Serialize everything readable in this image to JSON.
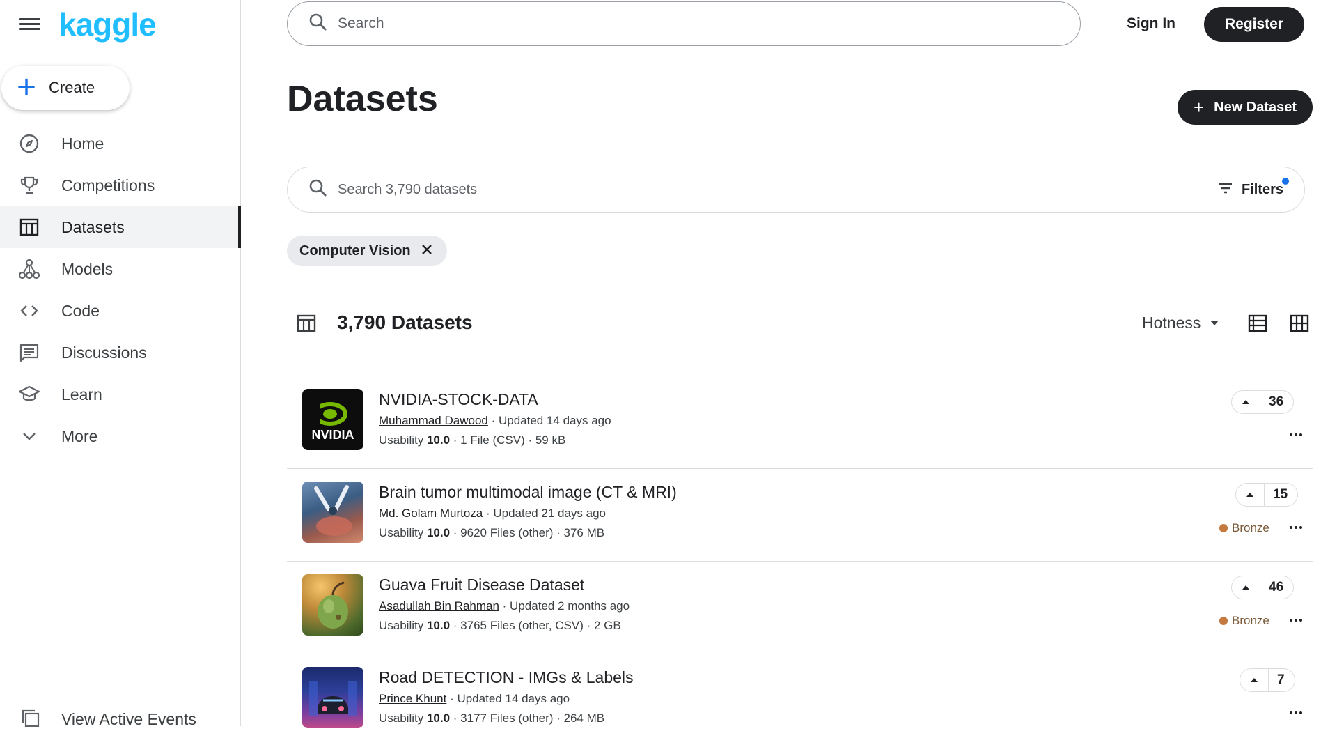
{
  "brand": {
    "logo_text": "kaggle",
    "accent": "#20beff"
  },
  "sidebar": {
    "create_label": "Create",
    "items": [
      {
        "label": "Home",
        "icon": "compass-icon"
      },
      {
        "label": "Competitions",
        "icon": "trophy-icon"
      },
      {
        "label": "Datasets",
        "icon": "table-icon",
        "active": true
      },
      {
        "label": "Models",
        "icon": "models-icon"
      },
      {
        "label": "Code",
        "icon": "code-icon"
      },
      {
        "label": "Discussions",
        "icon": "comments-icon"
      },
      {
        "label": "Learn",
        "icon": "school-icon"
      },
      {
        "label": "More",
        "icon": "chevron-down-icon"
      }
    ],
    "view_events_label": "View Active Events"
  },
  "topbar": {
    "search_placeholder": "Search",
    "sign_in": "Sign In",
    "register": "Register"
  },
  "page": {
    "title": "Datasets",
    "new_dataset": "New Dataset",
    "dataset_search_placeholder": "Search 3,790 datasets",
    "filters_label": "Filters",
    "active_filter": "Computer Vision",
    "result_count": "3,790 Datasets",
    "sort_label": "Hotness"
  },
  "datasets": [
    {
      "title": "NVIDIA-STOCK-DATA",
      "author": "Muhammad Dawood",
      "updated": " · Updated 14 days ago",
      "usability_label": "Usability ",
      "usability": "10.0",
      "files": " · 1 File (CSV) · 59 kB",
      "votes": "36",
      "medal": "",
      "thumb": "nvidia-logo"
    },
    {
      "title": "Brain tumor multimodal image (CT & MRI)",
      "author": "Md. Golam Murtoza",
      "updated": " · Updated 21 days ago",
      "usability_label": "Usability ",
      "usability": "10.0",
      "files": " · 9620 Files (other) · 376 MB",
      "votes": "15",
      "medal": "Bronze",
      "thumb": "surgery-photo"
    },
    {
      "title": "Guava Fruit Disease Dataset",
      "author": "Asadullah Bin Rahman",
      "updated": " · Updated 2 months ago",
      "usability_label": "Usability ",
      "usability": "10.0",
      "files": " · 3765 Files (other, CSV) · 2 GB",
      "votes": "46",
      "medal": "Bronze",
      "thumb": "guava-photo"
    },
    {
      "title": "Road DETECTION - IMGs & Labels",
      "author": "Prince Khunt",
      "updated": " · Updated 14 days ago",
      "usability_label": "Usability ",
      "usability": "10.0",
      "files": " · 3177 Files (other) · 264 MB",
      "votes": "7",
      "medal": "",
      "thumb": "car-photo"
    }
  ]
}
